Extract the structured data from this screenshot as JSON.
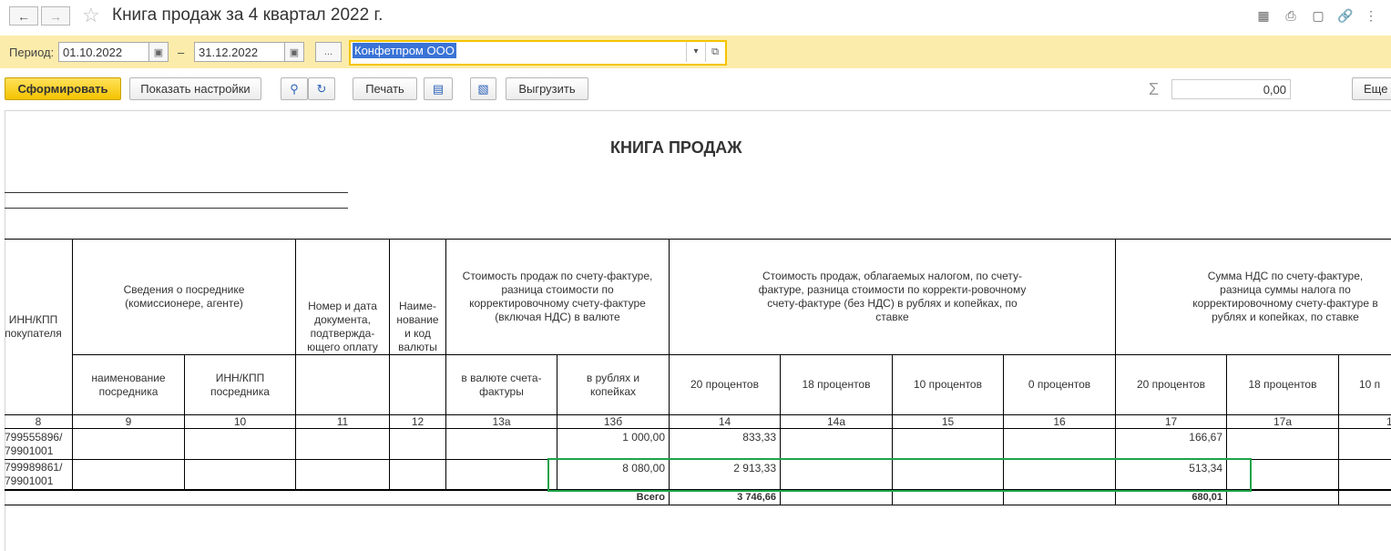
{
  "window": {
    "title": "Книга продаж за 4 квартал 2022 г."
  },
  "filter": {
    "period_label": "Период:",
    "date_from": "01.10.2022",
    "dash": "–",
    "date_to": "31.12.2022",
    "ellipsis": "...",
    "organization": "Конфетпром ООО"
  },
  "toolbar": {
    "generate": "Сформировать",
    "show_settings": "Показать настройки",
    "print": "Печать",
    "export": "Выгрузить",
    "sum_value": "0,00",
    "more": "Еще"
  },
  "report": {
    "title": "КНИГА ПРОДАЖ",
    "headers": {
      "inn_buyer": "ИНН/КПП покупателя",
      "intermediary": "Сведения о посреднике (комиссионере, агенте)",
      "intermediary_name": "наименование посредника",
      "intermediary_inn": "ИНН/КПП посредника",
      "payment_doc": "Номер и дата документа, подтвержда-ющего оплату",
      "currency": "Наиме-нование и код валюты",
      "cost_incl_vat": "Стоимость продаж по счету-фактуре, разница стоимости по корректировочному счету-фактуре (включая НДС) в валюте",
      "in_invoice_currency": "в валюте счета-фактуры",
      "in_rub": "в рублях и копейках",
      "cost_taxed": "Стоимость продаж, облагаемых налогом, по счету-фактуре, разница стоимости по корректи-ровочному счету-фактуре (без НДС) в рублях и копейках, по ставке",
      "vat_sum": "Сумма НДС по счету-фактуре, разница суммы налога по корректировочному счету-фактуре в рублях и копейках, по ставке",
      "rate_20": "20 процентов",
      "rate_18": "18 процентов",
      "rate_10": "10 процентов",
      "rate_0": "0 процентов",
      "rate_10_trunc": "10 п"
    },
    "col_numbers": [
      "8",
      "9",
      "10",
      "11",
      "12",
      "13а",
      "13б",
      "14",
      "14а",
      "15",
      "16",
      "17",
      "17а",
      "1"
    ],
    "rows": [
      {
        "inn": "799555896/ 79901001",
        "rub": "1 000,00",
        "c14": "833,33",
        "c17": "166,67"
      },
      {
        "inn": "799989861/ 79901001",
        "rub": "8 080,00",
        "c14": "2 913,33",
        "c17": "513,34"
      }
    ],
    "total": {
      "label": "Всего",
      "c14": "3 746,66",
      "c17": "680,01"
    }
  }
}
